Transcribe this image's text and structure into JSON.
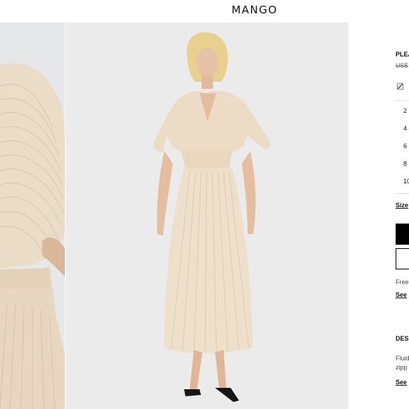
{
  "header": {
    "logo": "MANGO"
  },
  "product": {
    "title": "PLEA",
    "price": "US$",
    "sizes": [
      "2",
      "4",
      "6",
      "8",
      "10"
    ],
    "size_guide_label": "Size",
    "shipping_text": "Free",
    "shipping_link": "See",
    "description_heading": "DES",
    "description_line1": "Fluid",
    "description_line2": "zipp",
    "description_link": "See"
  },
  "colors": {
    "accent": "#000000",
    "dress": "#eadbc6",
    "background": "#ebebeb"
  }
}
